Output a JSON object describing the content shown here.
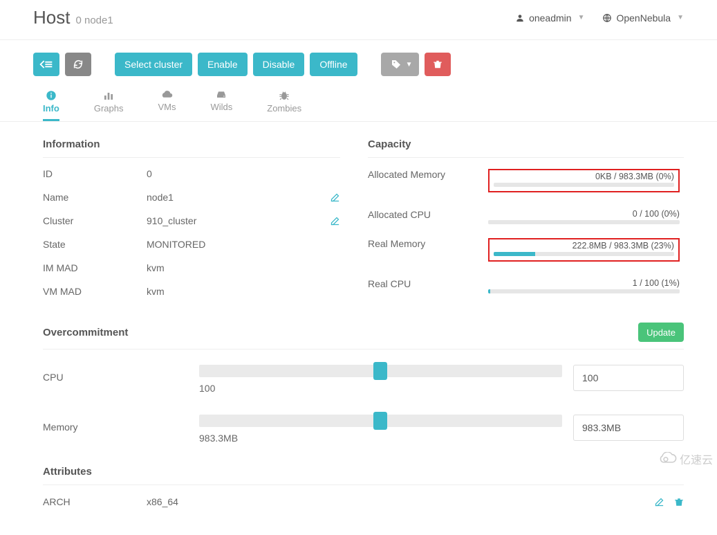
{
  "header": {
    "title": "Host",
    "subtitle": "0 node1",
    "user": "oneadmin",
    "brand": "OpenNebula"
  },
  "toolbar": {
    "select_cluster": "Select cluster",
    "enable": "Enable",
    "disable": "Disable",
    "offline": "Offline"
  },
  "tabs": {
    "info": "Info",
    "graphs": "Graphs",
    "vms": "VMs",
    "wilds": "Wilds",
    "zombies": "Zombies"
  },
  "info_section": {
    "title": "Information",
    "rows": {
      "id": {
        "k": "ID",
        "v": "0"
      },
      "name": {
        "k": "Name",
        "v": "node1"
      },
      "cluster": {
        "k": "Cluster",
        "v": "910_cluster"
      },
      "state": {
        "k": "State",
        "v": "MONITORED"
      },
      "im_mad": {
        "k": "IM MAD",
        "v": "kvm"
      },
      "vm_mad": {
        "k": "VM MAD",
        "v": "kvm"
      }
    }
  },
  "capacity": {
    "title": "Capacity",
    "alloc_mem": {
      "label": "Allocated Memory",
      "text": "0KB / 983.3MB (0%)",
      "pct": 0
    },
    "alloc_cpu": {
      "label": "Allocated CPU",
      "text": "0 / 100 (0%)",
      "pct": 0
    },
    "real_mem": {
      "label": "Real Memory",
      "text": "222.8MB / 983.3MB (23%)",
      "pct": 23
    },
    "real_cpu": {
      "label": "Real CPU",
      "text": "1 / 100 (1%)",
      "pct": 1
    }
  },
  "overcommit": {
    "title": "Overcommitment",
    "update": "Update",
    "cpu": {
      "label": "CPU",
      "slider_val": "100",
      "input": "100"
    },
    "memory": {
      "label": "Memory",
      "slider_val": "983.3MB",
      "input": "983.3MB"
    }
  },
  "attributes": {
    "title": "Attributes",
    "rows": [
      {
        "k": "ARCH",
        "v": "x86_64"
      }
    ]
  },
  "watermark": "亿速云"
}
